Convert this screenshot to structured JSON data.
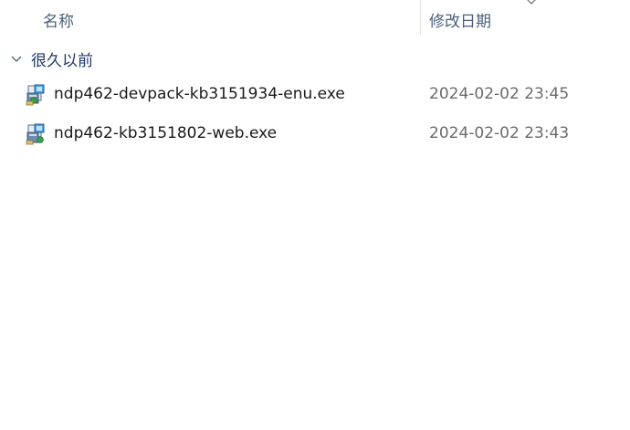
{
  "columns": {
    "name": "名称",
    "date_modified": "修改日期"
  },
  "group": {
    "label": "很久以前",
    "chevron_icon": "chevron-down-icon"
  },
  "files": [
    {
      "name": "ndp462-devpack-kb3151934-enu.exe",
      "date_modified": "2024-02-02 23:45",
      "icon": "installer-exe-icon"
    },
    {
      "name": "ndp462-kb3151802-web.exe",
      "date_modified": "2024-02-02 23:43",
      "icon": "installer-exe-icon"
    }
  ],
  "colors": {
    "header_text": "#4c607a",
    "group_text": "#1e3a66",
    "date_text": "#6b6b6b"
  }
}
